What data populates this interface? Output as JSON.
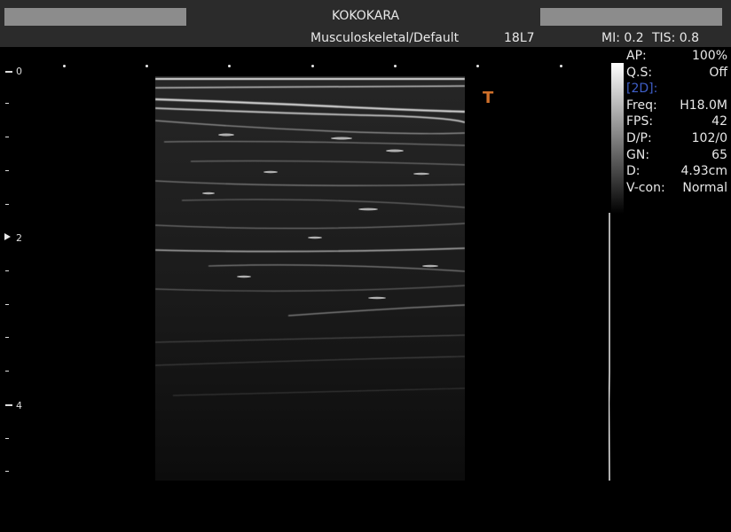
{
  "header": {
    "facility": "KOKOKARA",
    "preset": "Musculoskeletal/Default",
    "probe": "18L7",
    "mi": "MI:  0.2",
    "tis": "TIS:  0.8"
  },
  "depth_scale": {
    "labels": [
      "0",
      "2",
      "4"
    ]
  },
  "orientation_marker": "T",
  "params": {
    "rows_top": [
      {
        "label": "AP:",
        "value": "100%"
      },
      {
        "label": "Q.S:",
        "value": "Off"
      }
    ],
    "section": "[2D]:",
    "rows_2d": [
      {
        "label": "Freq:",
        "value": "H18.0M"
      },
      {
        "label": "FPS:",
        "value": "42"
      },
      {
        "label": "D/P:",
        "value": "102/0"
      },
      {
        "label": "GN:",
        "value": "65"
      },
      {
        "label": "D:",
        "value": "4.93cm"
      },
      {
        "label": "V-con:",
        "value": "Normal"
      }
    ]
  },
  "colors": {
    "header_bg": "#2b2b2b",
    "section_blue": "#3f5fc8",
    "marker_orange": "#d0702a"
  }
}
